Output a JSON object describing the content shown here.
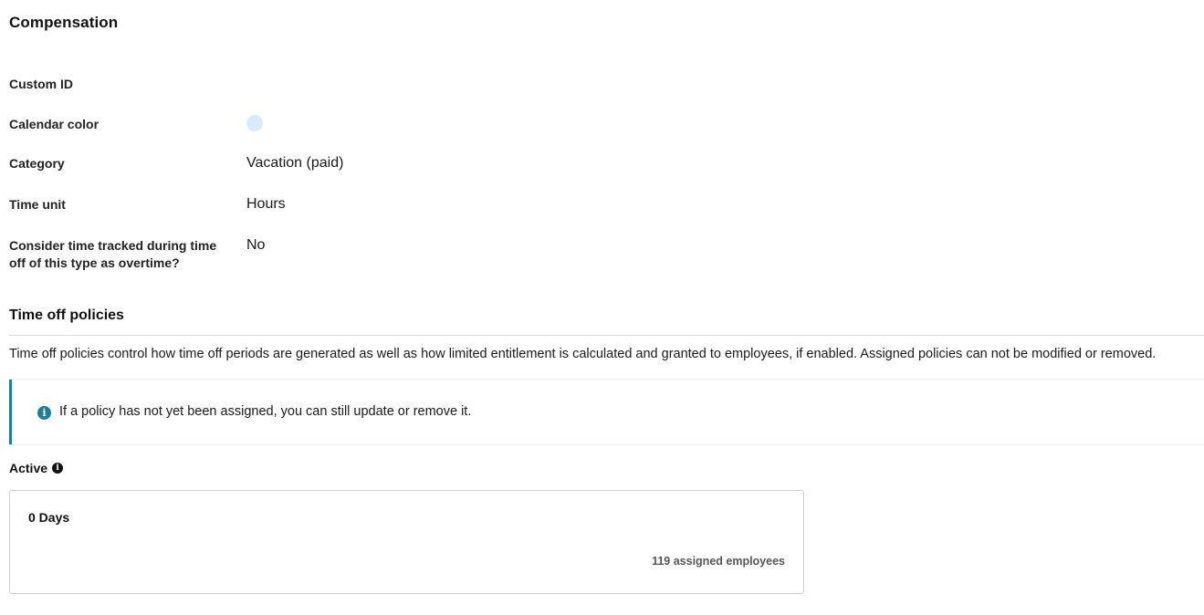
{
  "page": {
    "title": "Compensation"
  },
  "details": {
    "custom_id": {
      "label": "Custom ID",
      "value": ""
    },
    "calendar_color": {
      "label": "Calendar color",
      "color": "#d6ebfb"
    },
    "category": {
      "label": "Category",
      "value": "Vacation (paid)"
    },
    "time_unit": {
      "label": "Time unit",
      "value": "Hours"
    },
    "overtime": {
      "label": "Consider time tracked during time off of this type as overtime?",
      "value": "No"
    }
  },
  "policies": {
    "title": "Time off policies",
    "description": "Time off policies control how time off periods are generated as well as how limited entitlement is calculated and granted to employees, if enabled. Assigned policies can not be modified or removed.",
    "info": {
      "icon": "info-icon",
      "text": "If a policy has not yet been assigned, you can still update or remove it.",
      "accent_color": "#1b7f99"
    },
    "active": {
      "label": "Active",
      "icon": "info-icon",
      "items": [
        {
          "name": "0 Days",
          "assigned": "119 assigned employees"
        }
      ]
    }
  }
}
